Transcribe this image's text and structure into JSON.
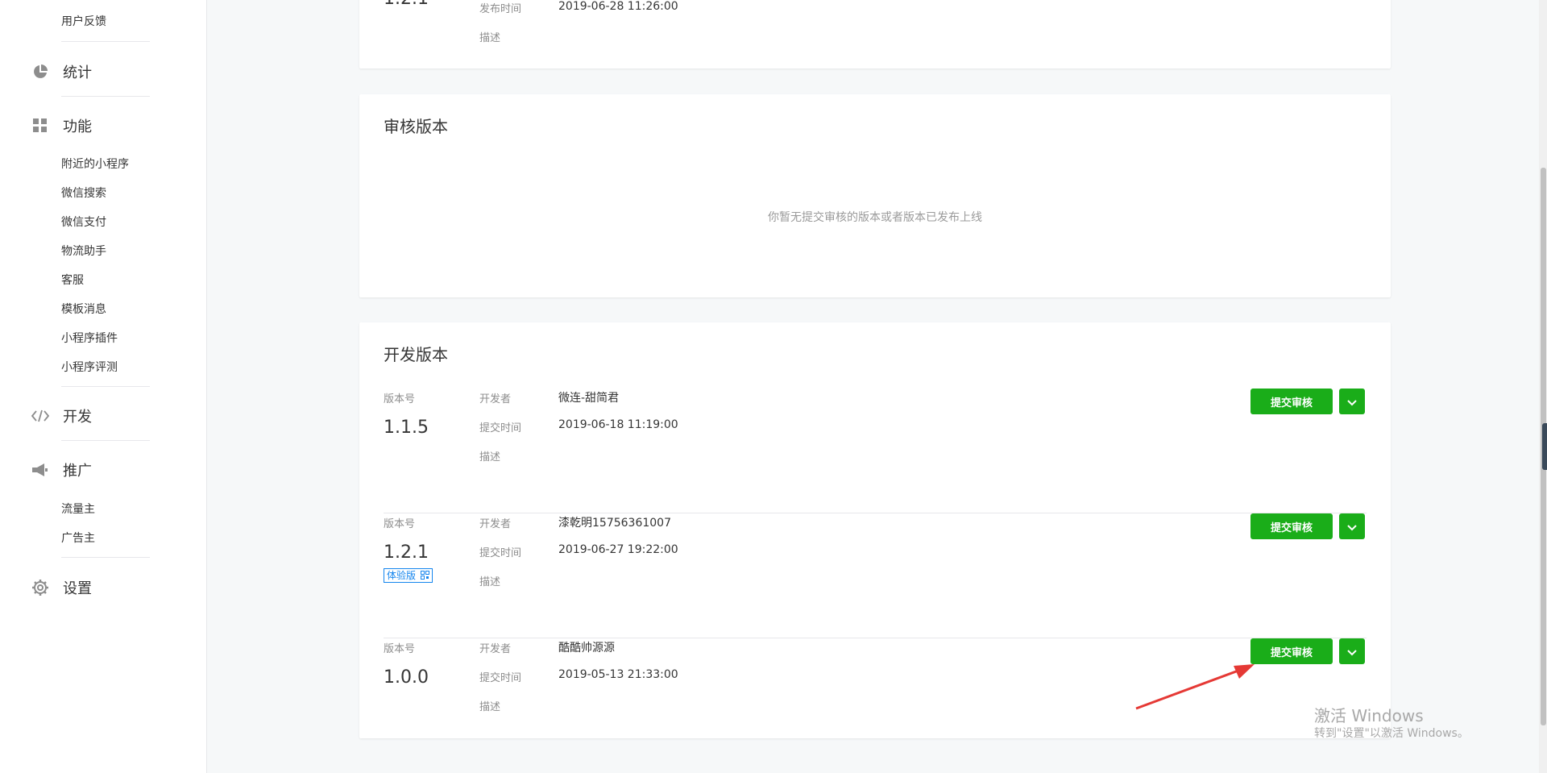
{
  "sidebar": {
    "top_item": "用户反馈",
    "groups": {
      "stats": "统计",
      "features": "功能",
      "develop": "开发",
      "promote": "推广",
      "settings": "设置"
    },
    "feature_items": [
      "附近的小程序",
      "微信搜索",
      "微信支付",
      "物流助手",
      "客服",
      "模板消息",
      "小程序插件",
      "小程序评测"
    ],
    "promote_items": [
      "流量主",
      "广告主"
    ]
  },
  "top_card": {
    "version_partial": "1.2.1",
    "publish_time_label": "发布时间",
    "publish_time": "2019-06-28 11:26:00",
    "desc_label": "描述"
  },
  "review_card": {
    "title": "审核版本",
    "empty_tip": "你暂无提交审核的版本或者版本已发布上线"
  },
  "dev_card": {
    "title": "开发版本",
    "labels": {
      "version": "版本号",
      "developer": "开发者",
      "submit_time": "提交时间",
      "desc": "描述"
    },
    "submit_button": "提交审核",
    "versions": [
      {
        "version": "1.1.5",
        "developer": "微连-甜简君",
        "submit_time": "2019-06-18 11:19:00"
      },
      {
        "version": "1.2.1",
        "developer": "漆乾明15756361007",
        "submit_time": "2019-06-27 19:22:00",
        "tag": "体验版"
      },
      {
        "version": "1.0.0",
        "developer": "酷酷帅源源",
        "submit_time": "2019-05-13 21:33:00"
      }
    ]
  },
  "watermark": {
    "line1": "激活 Windows",
    "line2": "转到\"设置\"以激活 Windows。"
  },
  "colors": {
    "accent_green": "#1aad19",
    "tag_blue": "#1485ee",
    "arrow_red": "#e53935"
  }
}
